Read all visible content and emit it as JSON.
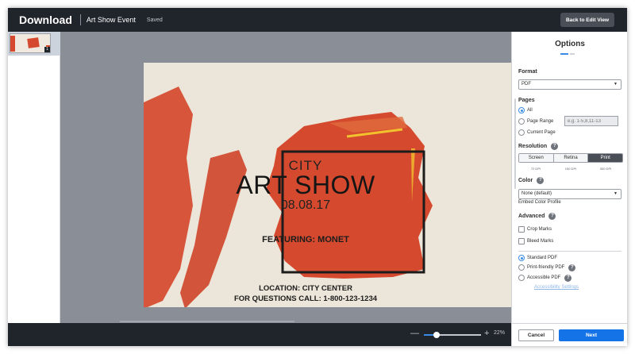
{
  "header": {
    "app_title": "Download",
    "document_title": "Art Show Event",
    "save_status": "Saved",
    "back_label": "Back to Edit View"
  },
  "thumbnails": [
    {
      "page_number": "1"
    }
  ],
  "artboard": {
    "city": "CITY",
    "title": "ART SHOW",
    "date": "08.08.17",
    "featuring": "FEATURING: MONET",
    "location": "LOCATION: CITY CENTER",
    "contact": "FOR QUESTIONS CALL:  1-800-123-1234",
    "colors": {
      "paper": "#ece5d9",
      "paint": "#d54a2e",
      "frame": "#1c1c1c",
      "accent": "#f2c12e"
    }
  },
  "zoom": {
    "minus_symbol": "—",
    "plus_symbol": "+",
    "level_label": "22%",
    "level_fraction": 0.22
  },
  "options": {
    "title": "Options",
    "format": {
      "label": "Format",
      "value": "PDF"
    },
    "pages": {
      "label": "Pages",
      "all_label": "All",
      "range_label": "Page Range",
      "range_placeholder": "e.g. 1-5,8,11-13",
      "current_label": "Current Page",
      "selected": "all"
    },
    "resolution": {
      "label": "Resolution",
      "options": [
        {
          "label": "Screen",
          "dpi": "72 DPI"
        },
        {
          "label": "Retina",
          "dpi": "150 DPI"
        },
        {
          "label": "Print",
          "dpi": "300 DPI"
        }
      ],
      "selected": "Print"
    },
    "color": {
      "label": "Color",
      "value": "None (default)",
      "embed_label": "Embed Color Profile"
    },
    "advanced": {
      "label": "Advanced",
      "crop_marks": "Crop Marks",
      "bleed_marks": "Bleed Marks"
    },
    "pdf_type": {
      "standard": "Standard PDF",
      "print_friendly": "Print-friendly PDF",
      "accessible": "Accessible PDF",
      "accessibility_link": "Accessibility Settings",
      "selected": "standard"
    },
    "help_symbol": "?",
    "caret_symbol": "▼",
    "cancel_label": "Cancel",
    "next_label": "Next"
  }
}
